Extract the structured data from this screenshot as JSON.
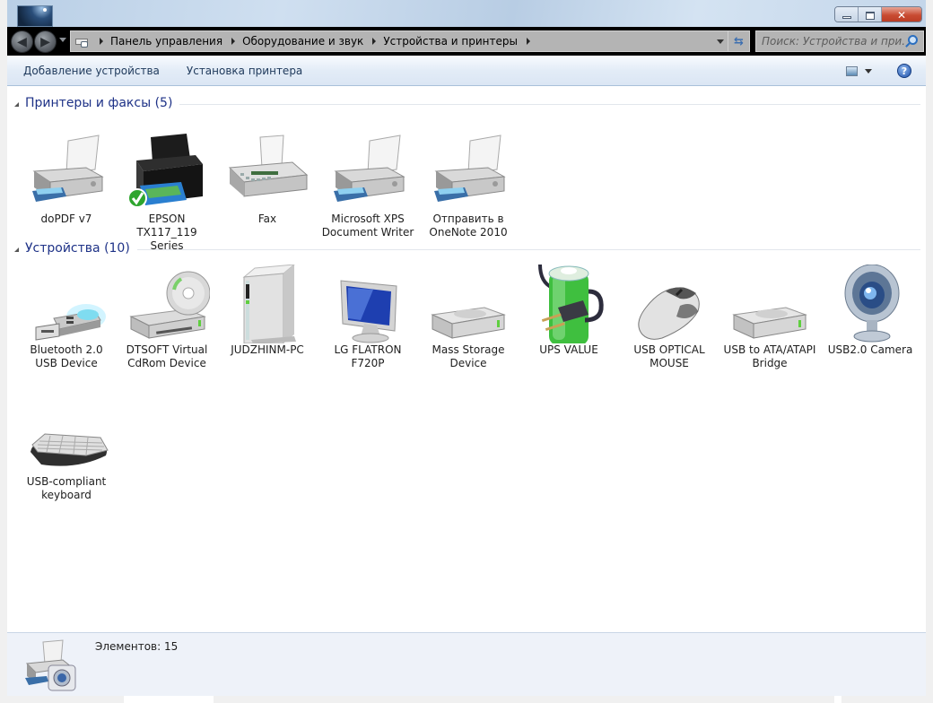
{
  "window": {
    "controls": {
      "minimize": "minimize",
      "maximize": "restore",
      "close": "x"
    }
  },
  "navigation": {
    "back_label": "Back",
    "forward_label": "Forward",
    "breadcrumbs": [
      "Панель управления",
      "Оборудование и звук",
      "Устройства и принтеры"
    ],
    "search_placeholder": "Поиск: Устройства и при...",
    "search_value": ""
  },
  "toolbar": {
    "add_device": "Добавление устройства",
    "add_printer": "Установка принтера",
    "help_glyph": "?"
  },
  "groups": [
    {
      "title": "Принтеры и факсы (5)",
      "items": [
        {
          "name": "doPDF v7",
          "icon": "printer-icon"
        },
        {
          "name": "EPSON TX117_119 Series",
          "icon": "inkjet-printer-icon",
          "default": true
        },
        {
          "name": "Fax",
          "icon": "fax-icon"
        },
        {
          "name": "Microsoft XPS Document Writer",
          "icon": "printer-icon"
        },
        {
          "name": "Отправить в OneNote 2010",
          "icon": "printer-icon"
        }
      ]
    },
    {
      "title": "Устройства (10)",
      "items": [
        {
          "name": "Bluetooth 2.0 USB Device",
          "icon": "usb-dongle-icon"
        },
        {
          "name": "DTSOFT Virtual CdRom Device",
          "icon": "cdrom-drive-icon"
        },
        {
          "name": "JUDZHINM-PC",
          "icon": "computer-tower-icon"
        },
        {
          "name": "LG FLATRON F720P",
          "icon": "monitor-icon"
        },
        {
          "name": "Mass Storage Device",
          "icon": "external-drive-icon"
        },
        {
          "name": "UPS VALUE",
          "icon": "ups-battery-icon"
        },
        {
          "name": "USB OPTICAL MOUSE",
          "icon": "mouse-icon"
        },
        {
          "name": "USB to ATA/ATAPI Bridge",
          "icon": "external-drive-icon"
        },
        {
          "name": "USB2.0 Camera",
          "icon": "webcam-icon"
        },
        {
          "name": "USB-compliant keyboard",
          "icon": "keyboard-icon"
        }
      ]
    }
  ],
  "status": {
    "text": "Элементов: 15"
  }
}
